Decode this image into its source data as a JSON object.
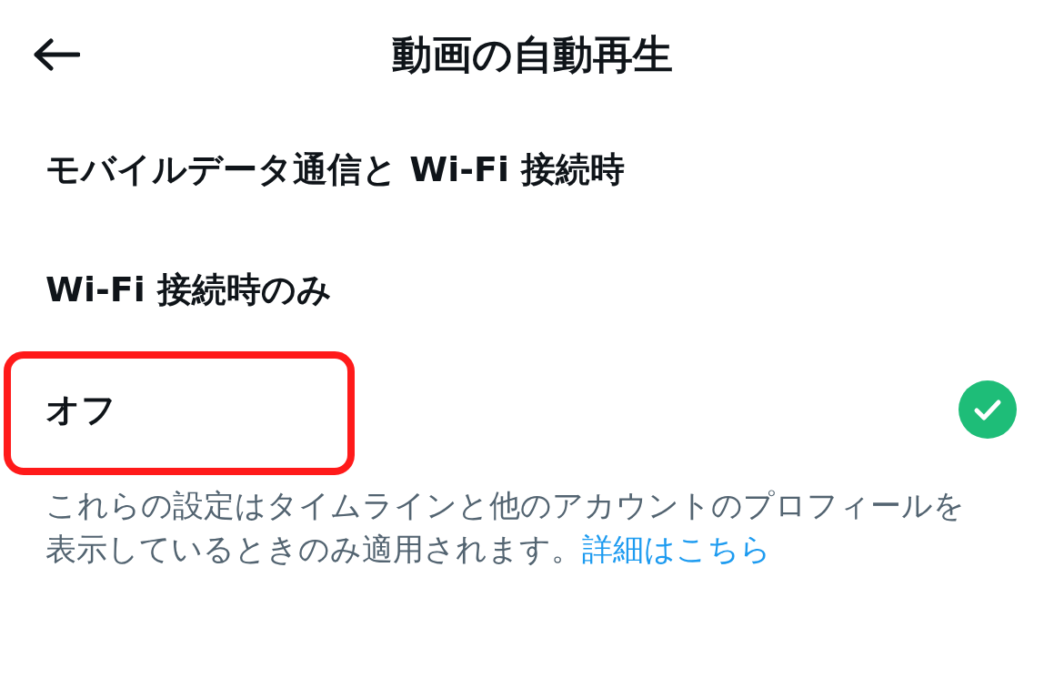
{
  "header": {
    "title": "動画の自動再生"
  },
  "options": [
    {
      "label": "モバイルデータ通信と Wi-Fi 接続時",
      "selected": false,
      "highlighted": false
    },
    {
      "label": "Wi-Fi 接続時のみ",
      "selected": false,
      "highlighted": false
    },
    {
      "label": "オフ",
      "selected": true,
      "highlighted": true
    }
  ],
  "note": {
    "text": "これらの設定はタイムラインと他のアカウントのプロフィールを表示しているときのみ適用されます。",
    "link": "詳細はこちら"
  }
}
